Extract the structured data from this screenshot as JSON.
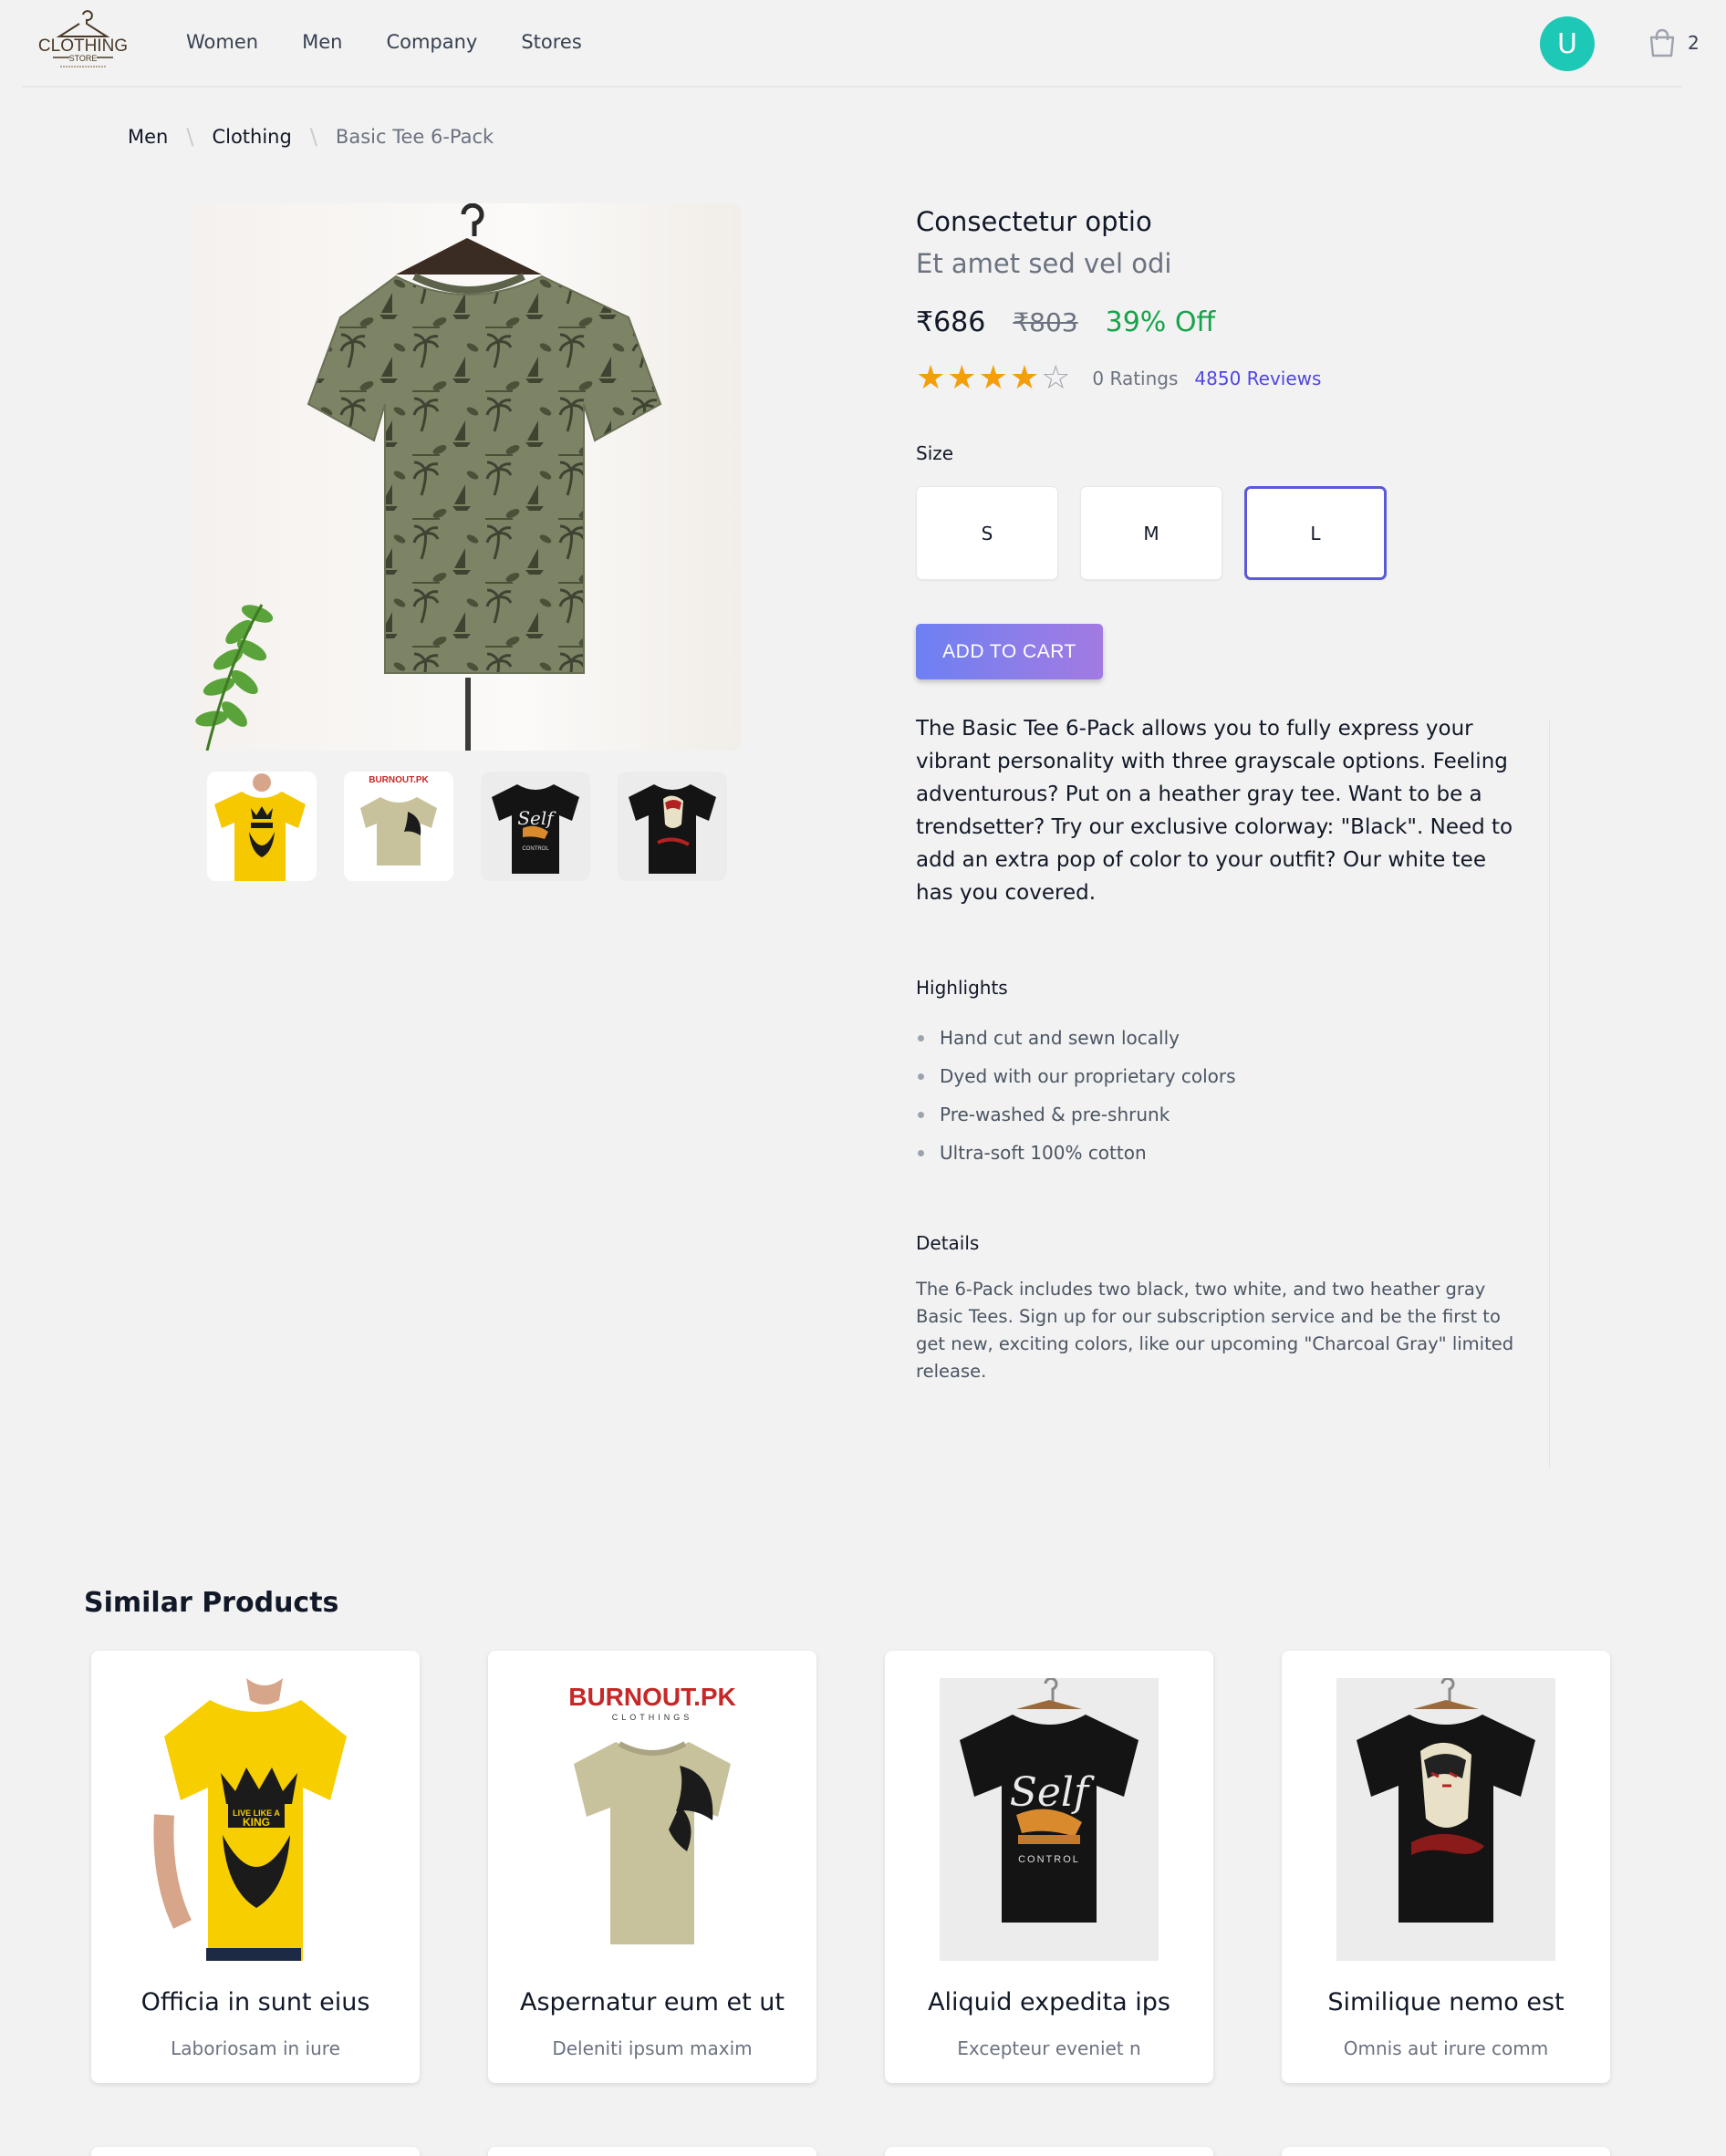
{
  "brand": {
    "logo_text": "CLOTHING",
    "logo_sub": "STORE"
  },
  "nav": {
    "items": [
      "Women",
      "Men",
      "Company",
      "Stores"
    ]
  },
  "user": {
    "avatar_initial": "U"
  },
  "cart": {
    "count": "2"
  },
  "breadcrumb": {
    "items": [
      "Men",
      "Clothing"
    ],
    "current": "Basic Tee 6-Pack"
  },
  "product": {
    "title": "Consectetur optio",
    "subtitle": "Et amet sed vel odi",
    "price": "₹686",
    "original_price": "₹803",
    "discount": "39% Off",
    "rating": 4,
    "rating_max": 5,
    "ratings_text": "0 Ratings",
    "reviews_text": "4850 Reviews",
    "size_label": "Size",
    "sizes": [
      "S",
      "M",
      "L"
    ],
    "selected_size": "L",
    "add_to_cart": "ADD TO CART",
    "description": "The Basic Tee 6-Pack allows you to fully express your vibrant personality with three grayscale options. Feeling adventurous? Put on a heather gray tee. Want to be a trendsetter? Try our exclusive colorway: \"Black\". Need to add an extra pop of color to your outfit? Our white tee has you covered.",
    "highlights_title": "Highlights",
    "highlights": [
      "Hand cut and sewn locally",
      "Dyed with our proprietary colors",
      "Pre-washed & pre-shrunk",
      "Ultra-soft 100% cotton"
    ],
    "details_title": "Details",
    "details": "The 6-Pack includes two black, two white, and two heather gray Basic Tees. Sign up for our subscription service and be the first to get new, exciting colors, like our upcoming \"Charcoal Gray\" limited release.",
    "thumbnails": [
      "yellow-king-tee",
      "burnout-lion-tee",
      "black-self-control-tee",
      "black-graphic-tee"
    ]
  },
  "similar": {
    "title": "Similar Products",
    "items": [
      {
        "title": "Officia in sunt eius",
        "subtitle": "Laboriosam in iure",
        "image": "yellow-king-tee"
      },
      {
        "title": "Aspernatur eum et ut",
        "subtitle": "Deleniti ipsum maxim",
        "image": "burnout-lion-tee"
      },
      {
        "title": "Aliquid expedita ips",
        "subtitle": "Excepteur eveniet n",
        "image": "black-self-control-tee"
      },
      {
        "title": "Similique nemo est",
        "subtitle": "Omnis aut irure comm",
        "image": "black-graphic-tee"
      }
    ]
  },
  "colors": {
    "accent": "#4f46e5",
    "avatar": "#1ec8b6",
    "discount": "#16a34a",
    "star": "#f59e0b"
  }
}
